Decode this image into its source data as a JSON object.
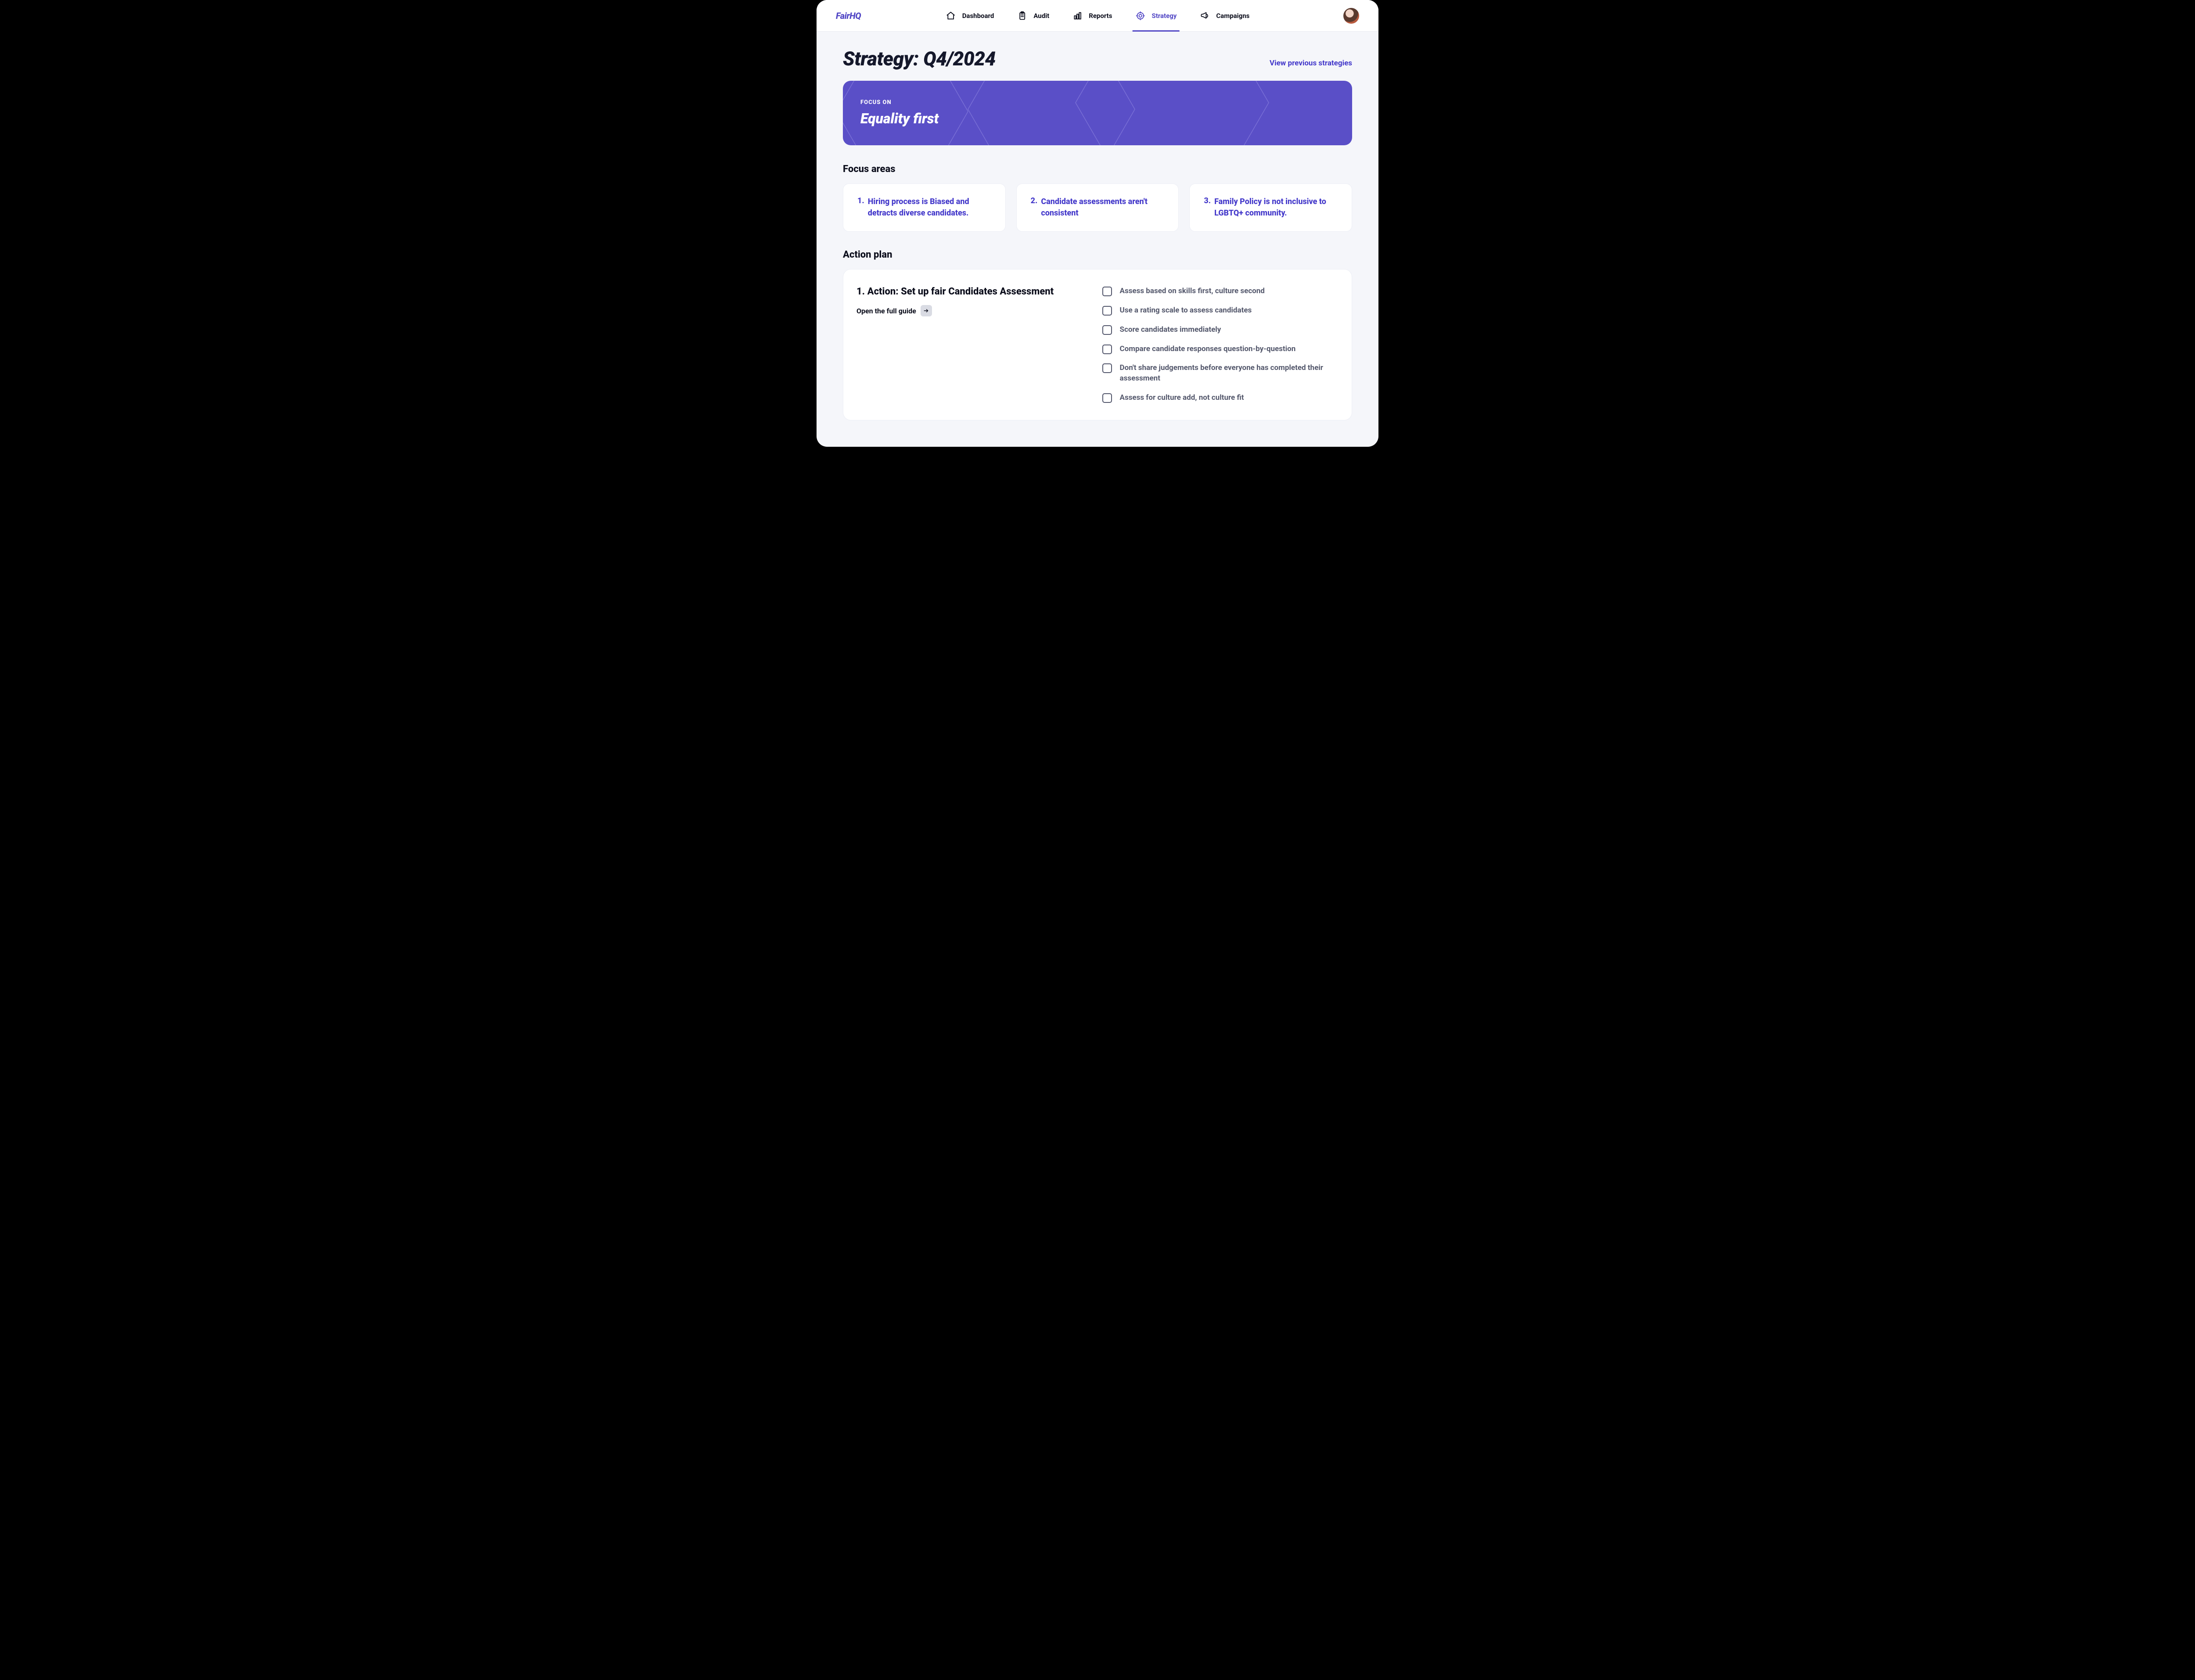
{
  "brand": "FairHQ",
  "nav": [
    {
      "label": "Dashboard",
      "active": false
    },
    {
      "label": "Audit",
      "active": false
    },
    {
      "label": "Reports",
      "active": false
    },
    {
      "label": "Strategy",
      "active": true
    },
    {
      "label": "Campaigns",
      "active": false
    }
  ],
  "page_title": "Strategy: Q4/2024",
  "prev_link": "View previous strategies",
  "banner": {
    "eyebrow": "FOCUS ON",
    "headline": "Equality first"
  },
  "focus_areas_title": "Focus areas",
  "focus_areas": [
    {
      "num": "1.",
      "text": "Hiring process is Biased and detracts diverse candidates."
    },
    {
      "num": "2.",
      "text": "Candidate assessments aren't consistent"
    },
    {
      "num": "3.",
      "text": "Family Policy is not inclusive to LGBTQ+ community."
    }
  ],
  "action_plan_title": "Action plan",
  "action": {
    "title": "1. Action: Set up fair Candidates Assessment",
    "guide_label": "Open the full guide",
    "checklist": [
      "Assess based on skills first, culture second",
      "Use a rating scale to assess candidates",
      "Score candidates immediately",
      "Compare candidate responses question-by-question",
      "Don't share judgements before everyone has completed their assessment",
      "Assess for culture add, not culture fit"
    ]
  }
}
